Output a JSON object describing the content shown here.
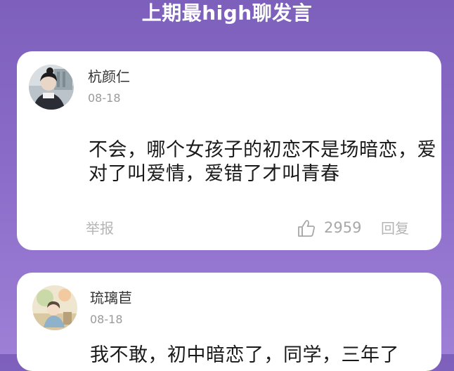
{
  "header": {
    "title": "上期最high聊发言"
  },
  "comments": [
    {
      "username": "杭颜仁",
      "date": "08-18",
      "text": "不会，哪个女孩子的初恋不是场暗恋，爱对了叫爱情，爱错了才叫青春",
      "report_label": "举报",
      "like_icon": "thumbs-up-icon",
      "likes": "2959",
      "reply_label": "回复"
    },
    {
      "username": "琉璃苣",
      "date": "08-18",
      "text": "我不敢，初中暗恋了，同学，三年了"
    }
  ],
  "colors": {
    "background_top": "#7d60bc",
    "background_bottom": "#9e7fd6",
    "card": "#ffffff",
    "meta_text": "#9a9a9a"
  }
}
